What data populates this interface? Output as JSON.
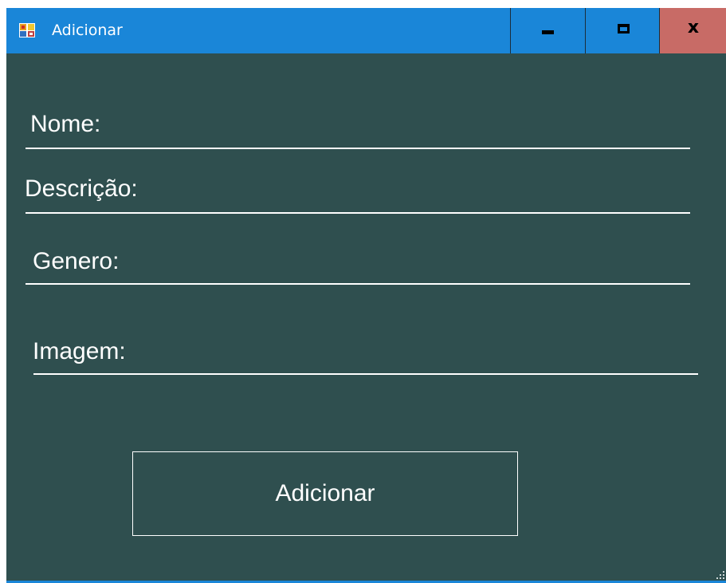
{
  "window": {
    "title": "Adicionar",
    "app_icon": "windows-forms-app-icon",
    "controls": {
      "minimize": "minimize-icon",
      "maximize": "maximize-icon",
      "close_glyph": "x"
    }
  },
  "form": {
    "fields": [
      {
        "label": "Nome:"
      },
      {
        "label": "Descrição:"
      },
      {
        "label": "Genero:"
      },
      {
        "label": "Imagem:"
      }
    ],
    "submit_label": "Adicionar"
  },
  "colors": {
    "form_background": "#2f4f4f",
    "titlebar": "#1a86d8",
    "close_button": "#c86b66",
    "text": "#ffffff"
  }
}
